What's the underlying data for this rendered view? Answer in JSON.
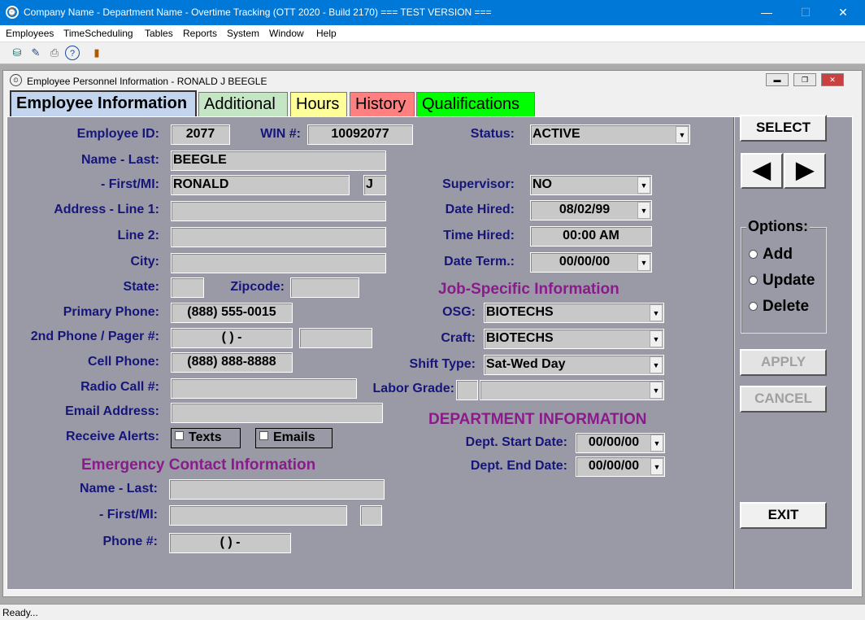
{
  "window": {
    "title": "Company Name - Department Name - Overtime Tracking (OTT 2020 - Build 2170) === TEST VERSION ==="
  },
  "menu": [
    "Employees",
    "TimeScheduling",
    "Tables",
    "Reports",
    "System",
    "Window",
    "Help"
  ],
  "toolbar": [
    "database-icon",
    "edit-icon",
    "print-icon",
    "help-icon",
    "exit-door-icon"
  ],
  "child": {
    "title": "Employee Personnel Information - RONALD J BEEGLE"
  },
  "tabs": [
    {
      "label": "Employee Information",
      "color": "#c3d4ee"
    },
    {
      "label": "Additional",
      "color": "#c4e6c4"
    },
    {
      "label": "Hours",
      "color": "#ffff99"
    },
    {
      "label": "History",
      "color": "#ff8080"
    },
    {
      "label": "Qualifications",
      "color": "#00ff00"
    }
  ],
  "labels": {
    "employee_id": "Employee ID:",
    "win": "WIN #:",
    "status": "Status:",
    "name_last": "Name - Last:",
    "first_mi": "- First/MI:",
    "supervisor": "Supervisor:",
    "address1": "Address - Line 1:",
    "date_hired": "Date Hired:",
    "line2": "Line 2:",
    "time_hired": "Time Hired:",
    "city": "City:",
    "date_term": "Date Term.:",
    "state": "State:",
    "zipcode": "Zipcode:",
    "primary_phone": "Primary Phone:",
    "osg": "OSG:",
    "second_phone": "2nd Phone / Pager #:",
    "craft": "Craft:",
    "cell_phone": "Cell Phone:",
    "shift_type": "Shift Type:",
    "radio_call": "Radio Call #:",
    "labor_grade": "Labor Grade:",
    "email": "Email Address:",
    "receive_alerts": "Receive Alerts:",
    "dept_start": "Dept. Start Date:",
    "dept_end": "Dept. End Date:",
    "ec_name_last": "Name - Last:",
    "ec_first_mi": "- First/MI:",
    "ec_phone": "Phone #:"
  },
  "sections": {
    "job": "Job-Specific  Information",
    "dept": "DEPARTMENT INFORMATION",
    "emergency": "Emergency Contact Information"
  },
  "fields": {
    "employee_id": "2077",
    "win": "10092077",
    "status": "ACTIVE",
    "name_last": "BEEGLE",
    "first": "RONALD",
    "mi": "J",
    "supervisor": "NO",
    "date_hired": "08/02/99",
    "time_hired": "00:00 AM",
    "date_term": "00/00/00",
    "primary_phone": "(888) 555-0015",
    "second_phone": "(   )    -",
    "cell_phone": "(888) 888-8888",
    "osg": "BIOTECHS",
    "craft": "BIOTECHS",
    "shift_type": "Sat-Wed Day",
    "dept_start": "00/00/00",
    "dept_end": "00/00/00",
    "ec_phone": "(   )    -"
  },
  "alerts": {
    "texts": "Texts",
    "emails": "Emails"
  },
  "buttons": {
    "select": "SELECT",
    "apply": "APPLY",
    "cancel": "CANCEL",
    "exit": "EXIT"
  },
  "options": {
    "title": "Options:",
    "add": "Add",
    "update": "Update",
    "delete": "Delete"
  },
  "statusbar": "Ready..."
}
